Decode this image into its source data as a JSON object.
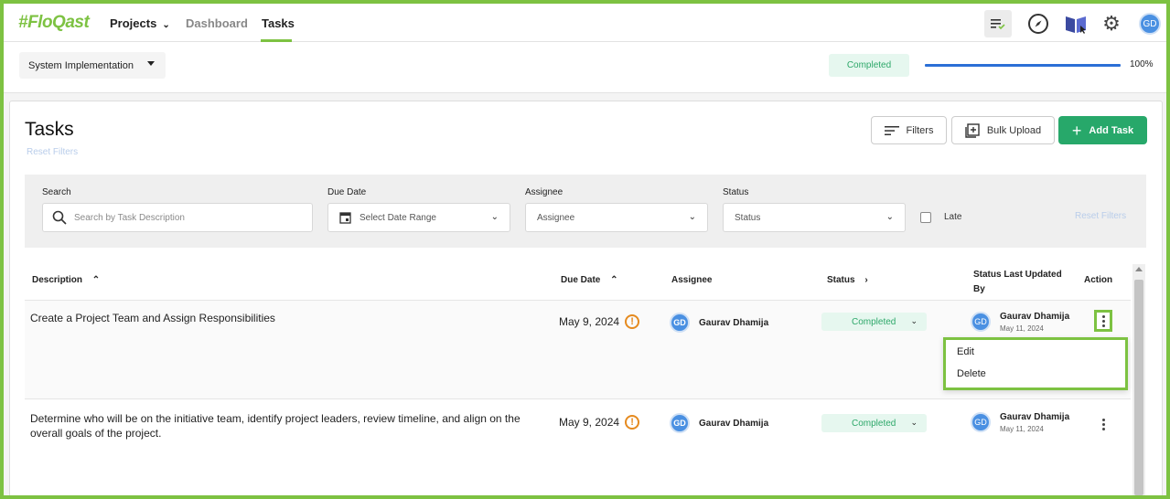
{
  "topnav": {
    "logo": "#FloQast",
    "items": [
      {
        "label": "Projects"
      },
      {
        "label": "Dashboard"
      },
      {
        "label": "Tasks"
      }
    ],
    "avatar_initials": "GD"
  },
  "subheader": {
    "project": "System Implementation",
    "status": "Completed",
    "progress_percent": 100,
    "progress_label": "100%"
  },
  "page": {
    "title": "Tasks",
    "reset_filters": "Reset Filters",
    "buttons": {
      "filters": "Filters",
      "bulk_upload": "Bulk Upload",
      "add_task": "Add Task"
    }
  },
  "filters": {
    "search_label": "Search",
    "search_placeholder": "Search by Task Description",
    "due_label": "Due Date",
    "due_value": "Select Date Range",
    "assignee_label": "Assignee",
    "assignee_value": "Assignee",
    "status_label": "Status",
    "status_value": "Status",
    "late_label": "Late",
    "reset": "Reset Filters"
  },
  "table": {
    "columns": {
      "description": "Description",
      "due_date": "Due Date",
      "assignee": "Assignee",
      "status": "Status",
      "status_updated_line1": "Status Last Updated",
      "status_updated_line2": "By",
      "action": "Action"
    },
    "rows": [
      {
        "description": "Create a Project Team and Assign Responsibilities",
        "due_date": "May 9, 2024",
        "assignee_initials": "GD",
        "assignee": "Gaurav Dhamija",
        "status": "Completed",
        "updated_initials": "GD",
        "updated_by": "Gaurav Dhamija",
        "updated_date": "May 11, 2024"
      },
      {
        "description": "Determine who will be on the initiative team, identify project leaders, review timeline, and align on the overall goals of the project.",
        "due_date": "May 9, 2024",
        "assignee_initials": "GD",
        "assignee": "Gaurav Dhamija",
        "status": "Completed",
        "updated_initials": "GD",
        "updated_by": "Gaurav Dhamija",
        "updated_date": "May 11, 2024"
      }
    ]
  },
  "action_menu": {
    "items": [
      "Edit",
      "Delete"
    ]
  },
  "colors": {
    "accent_green": "#7dc242",
    "add_button": "#27a86a",
    "status_text": "#2ea86a",
    "progress": "#2b6fd6"
  }
}
